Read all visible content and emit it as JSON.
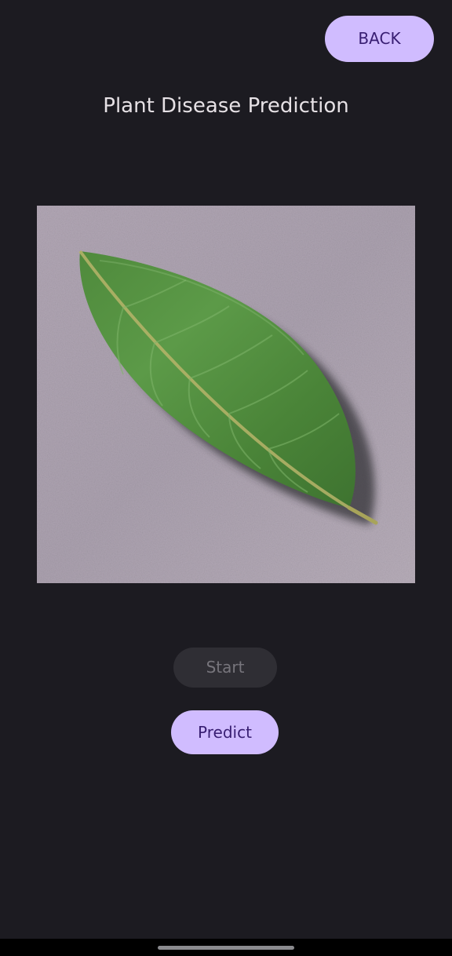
{
  "header": {
    "back_label": "BACK"
  },
  "main": {
    "title": "Plant Disease Prediction",
    "image_subject": "leaf-photo",
    "start_label": "Start",
    "predict_label": "Predict"
  },
  "colors": {
    "background": "#1c1b21",
    "primary_button": "#d0bcff",
    "primary_button_text": "#381e72",
    "disabled_button": "#2f2e34",
    "disabled_button_text": "#77757c",
    "title_text": "#e6e1e5"
  }
}
